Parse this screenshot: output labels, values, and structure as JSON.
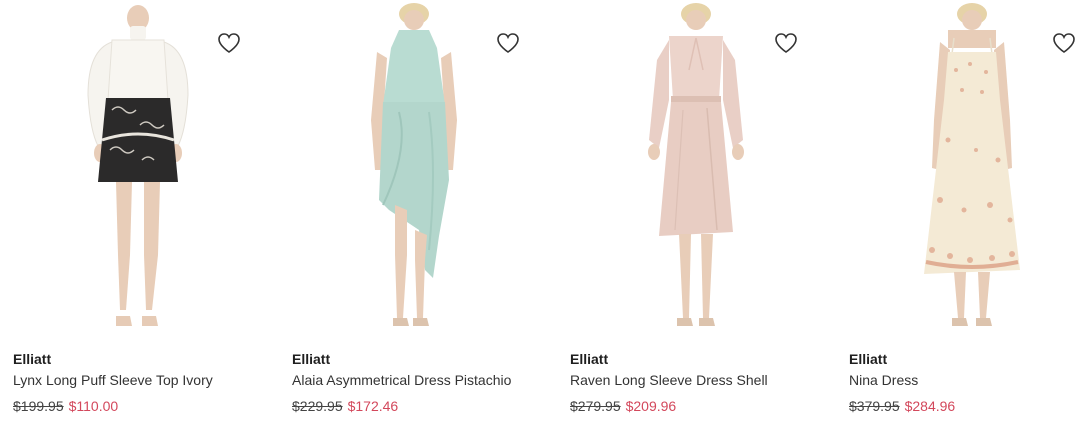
{
  "products": [
    {
      "brand": "Elliatt",
      "name": "Lynx Long Puff Sleeve Top Ivory",
      "original_price": "$199.95",
      "sale_price": "$110.00",
      "wishlist_icon": "heart-outline-icon",
      "garment": "ivory puff sleeve blouse with black embroidered mini skirt"
    },
    {
      "brand": "Elliatt",
      "name": "Alaia Asymmetrical Dress Pistachio",
      "original_price": "$229.95",
      "sale_price": "$172.46",
      "wishlist_icon": "heart-outline-icon",
      "garment": "pistachio satin asymmetrical halter dress"
    },
    {
      "brand": "Elliatt",
      "name": "Raven Long Sleeve Dress Shell",
      "original_price": "$279.95",
      "sale_price": "$209.96",
      "wishlist_icon": "heart-outline-icon",
      "garment": "shell pink long sleeve satin midi dress"
    },
    {
      "brand": "Elliatt",
      "name": "Nina Dress",
      "original_price": "$379.95",
      "sale_price": "$284.96",
      "wishlist_icon": "heart-outline-icon",
      "garment": "cream embellished strappy midi dress"
    }
  ],
  "colors": {
    "sale_price": "#d3485c",
    "original_price": "#444444",
    "brand": "#1f1f1f",
    "skin": "#e8cdb8",
    "hair": "#e6d3a8",
    "blouse": "#f6f4ef",
    "skirt": "#2b2a2a",
    "pistachio": "#b9dcd2",
    "shell": "#e9cfc6",
    "cream": "#f4ead5"
  }
}
